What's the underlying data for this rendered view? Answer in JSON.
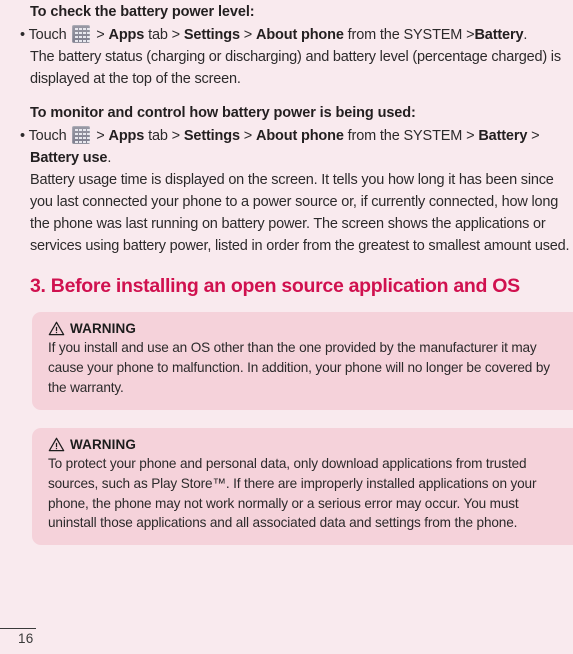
{
  "page": {
    "background_color": "#f9eaee",
    "number": "16"
  },
  "section_a": {
    "heading": "To check the battery power level:",
    "bullet": {
      "dot": "•",
      "touch_label": "Touch",
      "icon": "apps-grid-icon",
      "sep1": ">",
      "apps": "Apps",
      "tab": "tab",
      "sep2": ">",
      "settings": "Settings",
      "sep3": ">",
      "about_phone": "About phone",
      "from_system": "from the SYSTEM",
      "sep4": ">",
      "battery": "Battery",
      "period": "."
    },
    "paragraph": "The battery status (charging or discharging) and battery level (percentage charged) is displayed at the top of the screen."
  },
  "section_b": {
    "heading": "To monitor and control how battery power is being used:",
    "bullet": {
      "dot": "•",
      "touch_label": "Touch",
      "icon": "apps-grid-icon",
      "sep1": ">",
      "apps": "Apps",
      "tab": "tab",
      "sep2": ">",
      "settings": "Settings",
      "sep3": ">",
      "about_phone": "About phone",
      "from_system": "from the SYSTEM",
      "sep4": ">",
      "battery": "Battery",
      "sep5": ">",
      "battery_use": "Battery use",
      "period": "."
    },
    "paragraph": "Battery usage time is displayed on the screen. It tells you how long it has been since you last connected your phone to a power source or, if currently connected, how long the phone was last running on battery power. The screen shows the applications or services using battery power, listed in order from the greatest to smallest amount used."
  },
  "section_heading": {
    "text": "3. Before installing an open source application and OS",
    "color": "#d0114f"
  },
  "warnings": [
    {
      "icon": "warning-triangle-icon",
      "title": "WARNING",
      "body": "If you install and use an OS other than the one provided by the manufacturer it may cause your phone to malfunction. In addition, your phone will no longer be covered by the warranty.",
      "background_color": "#f5d2da"
    },
    {
      "icon": "warning-triangle-icon",
      "title": "WARNING",
      "body": "To protect your phone and personal data, only download applications from trusted sources, such as Play Store™. If there are improperly installed applications on your phone, the phone may not work normally or a serious error may occur. You must uninstall those applications and all associated data and settings from the phone.",
      "background_color": "#f5d2da"
    }
  ]
}
